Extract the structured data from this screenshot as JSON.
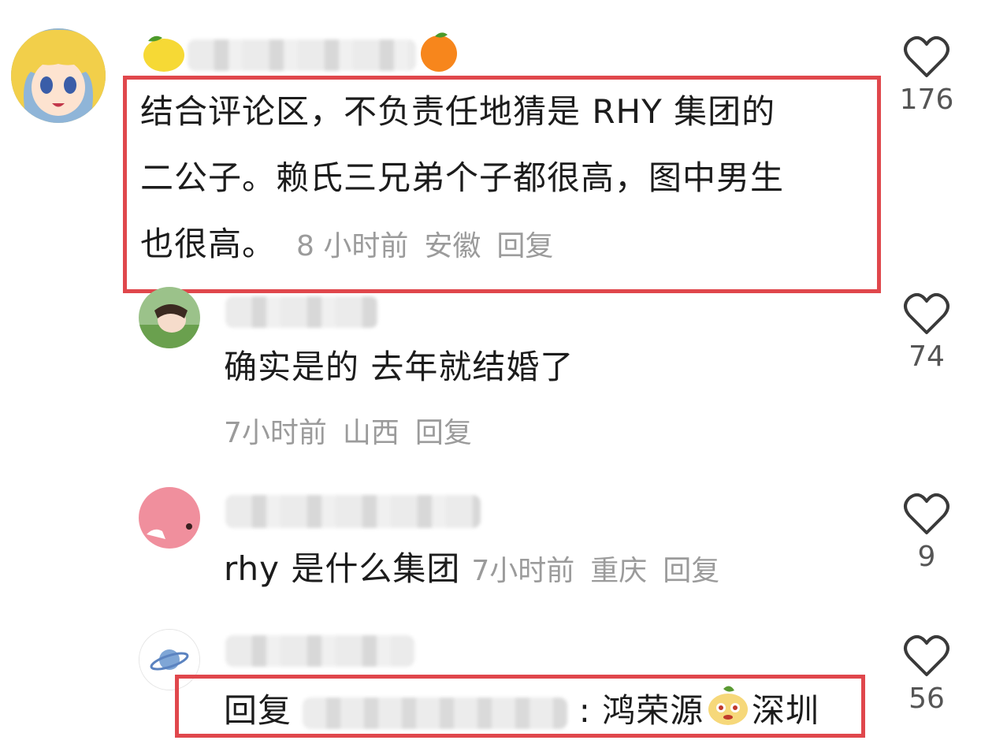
{
  "comments": [
    {
      "text_line1": "结合评论区，不负责任地猜是 RHY 集团的",
      "text_line2": "二公子。赖氏三兄弟个子都很高，图中男生",
      "text_line3": "也很高。",
      "time": "8 小时前",
      "location": "安徽",
      "reply_label": "回复",
      "likes": "176"
    },
    {
      "text": "确实是的 去年就结婚了",
      "time": "7小时前",
      "location": "山西",
      "reply_label": "回复",
      "likes": "74"
    },
    {
      "text": "rhy 是什么集团",
      "time": "7小时前",
      "location": "重庆",
      "reply_label": "回复",
      "likes": "9"
    },
    {
      "reply_prefix": "回复",
      "colon_text": ": 鸿荣源",
      "location_text": "深圳",
      "likes": "56"
    }
  ],
  "colors": {
    "highlight": "#e0474c",
    "meta_gray": "#9b9b9b"
  },
  "icons": [
    "lemon-emoji",
    "orange-emoji",
    "heart-icon",
    "planet-icon",
    "mascot-emoji"
  ]
}
